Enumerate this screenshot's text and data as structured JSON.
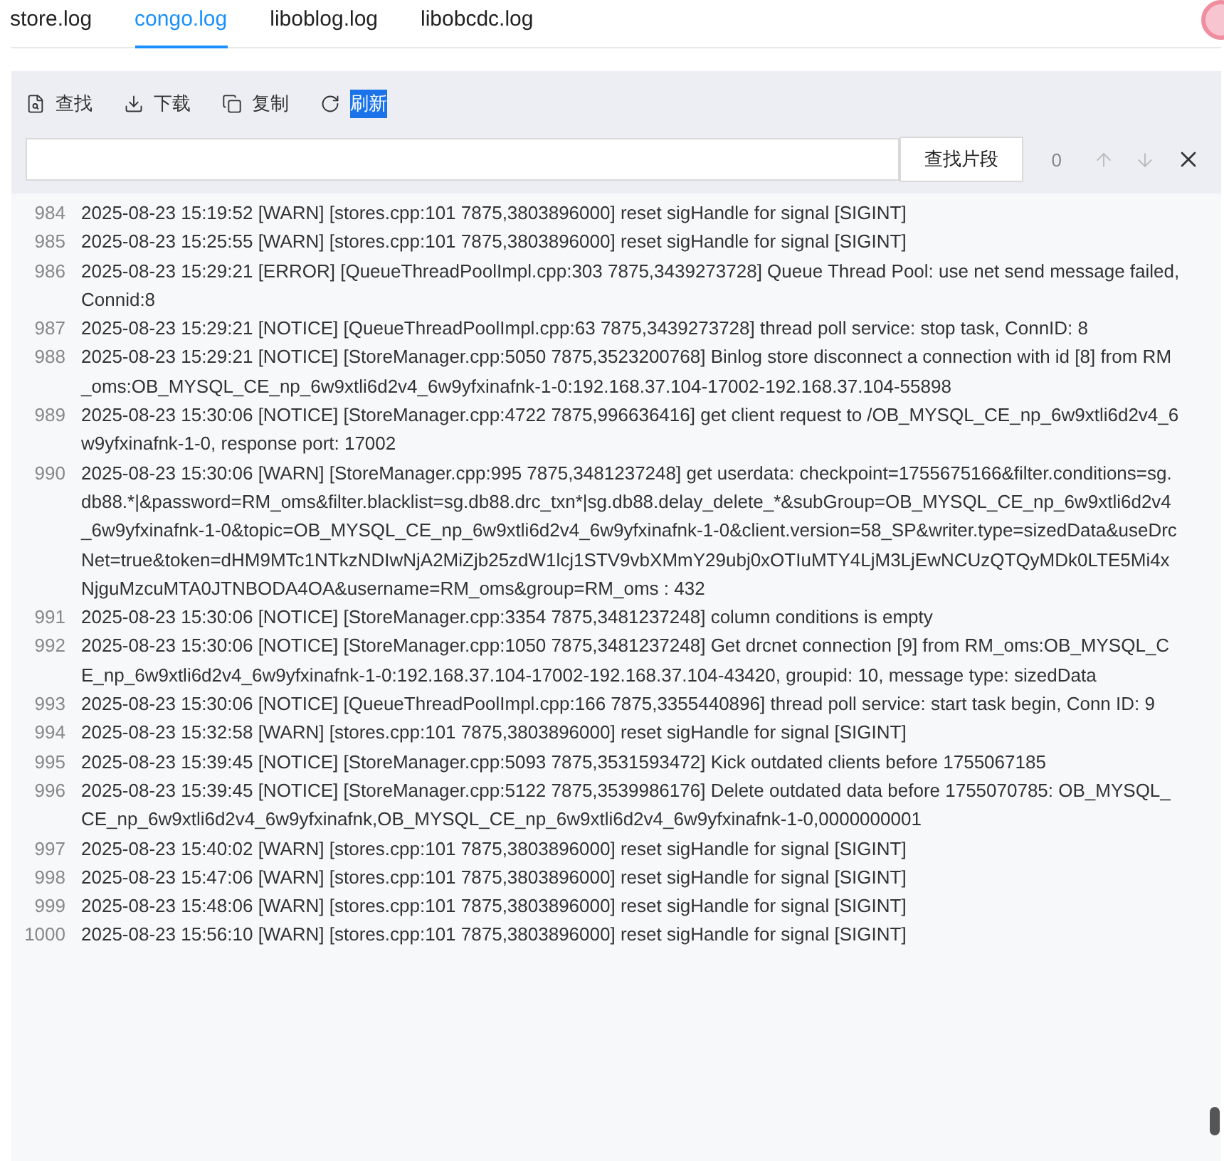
{
  "tabs": [
    {
      "label": "store.log",
      "selected": false
    },
    {
      "label": "congo.log",
      "selected": true
    },
    {
      "label": "liboblog.log",
      "selected": false
    },
    {
      "label": "libobcdc.log",
      "selected": false
    }
  ],
  "toolbar": [
    {
      "kind": "find",
      "label": "查找",
      "highlighted": false
    },
    {
      "kind": "download",
      "label": "下载",
      "highlighted": false
    },
    {
      "kind": "copy",
      "label": "复制",
      "highlighted": false
    },
    {
      "kind": "refresh",
      "label": "刷新",
      "highlighted": true
    }
  ],
  "search": {
    "button": "查找片段",
    "count": "0"
  },
  "log": [
    {
      "line": "984",
      "text": "2025-08-23 15:19:52 [WARN] [stores.cpp:101 7875,3803896000] reset sigHandle for signal [SIGINT]"
    },
    {
      "line": "985",
      "text": "2025-08-23 15:25:55 [WARN] [stores.cpp:101 7875,3803896000] reset sigHandle for signal [SIGINT]"
    },
    {
      "line": "986",
      "text": "2025-08-23 15:29:21 [ERROR] [QueueThreadPoolImpl.cpp:303 7875,3439273728] Queue Thread Pool: use net send message failed, Connid:8"
    },
    {
      "line": "987",
      "text": "2025-08-23 15:29:21 [NOTICE] [QueueThreadPoolImpl.cpp:63 7875,3439273728] thread poll service: stop task, ConnID: 8"
    },
    {
      "line": "988",
      "text": "2025-08-23 15:29:21 [NOTICE] [StoreManager.cpp:5050 7875,3523200768] Binlog store disconnect a connection with id [8] from RM_oms:OB_MYSQL_CE_np_6w9xtli6d2v4_6w9yfxinafnk-1-0:192.168.37.104-17002-192.168.37.104-55898"
    },
    {
      "line": "989",
      "text": "2025-08-23 15:30:06 [NOTICE] [StoreManager.cpp:4722 7875,996636416] get client request to /OB_MYSQL_CE_np_6w9xtli6d2v4_6w9yfxinafnk-1-0, response port: 17002"
    },
    {
      "line": "990",
      "text": "2025-08-23 15:30:06 [WARN] [StoreManager.cpp:995 7875,3481237248] get userdata: checkpoint=1755675166&filter.conditions=sg.db88.*|&password=RM_oms&filter.blacklist=sg.db88.drc_txn*|sg.db88.delay_delete_*&subGroup=OB_MYSQL_CE_np_6w9xtli6d2v4_6w9yfxinafnk-1-0&topic=OB_MYSQL_CE_np_6w9xtli6d2v4_6w9yfxinafnk-1-0&client.version=58_SP&writer.type=sizedData&useDrcNet=true&token=dHM9MTc1NTkzNDIwNjA2MiZjb25zdW1lcj1STV9vbXMmY29ubj0xOTIuMTY4LjM3LjEwNCUzQTQyMDk0LTE5Mi4xNjguMzcuMTA0JTNBODA4OA&username=RM_oms&group=RM_oms : 432"
    },
    {
      "line": "991",
      "text": "2025-08-23 15:30:06 [NOTICE] [StoreManager.cpp:3354 7875,3481237248] column conditions is empty"
    },
    {
      "line": "992",
      "text": "2025-08-23 15:30:06 [NOTICE] [StoreManager.cpp:1050 7875,3481237248] Get drcnet connection [9] from RM_oms:OB_MYSQL_CE_np_6w9xtli6d2v4_6w9yfxinafnk-1-0:192.168.37.104-17002-192.168.37.104-43420, groupid: 10, message type: sizedData"
    },
    {
      "line": "993",
      "text": "2025-08-23 15:30:06 [NOTICE] [QueueThreadPoolImpl.cpp:166 7875,3355440896] thread poll service: start task begin, Conn ID: 9"
    },
    {
      "line": "994",
      "text": "2025-08-23 15:32:58 [WARN] [stores.cpp:101 7875,3803896000] reset sigHandle for signal [SIGINT]"
    },
    {
      "line": "995",
      "text": "2025-08-23 15:39:45 [NOTICE] [StoreManager.cpp:5093 7875,3531593472] Kick outdated clients before 1755067185"
    },
    {
      "line": "996",
      "text": "2025-08-23 15:39:45 [NOTICE] [StoreManager.cpp:5122 7875,3539986176] Delete outdated data before 1755070785: OB_MYSQL_CE_np_6w9xtli6d2v4_6w9yfxinafnk,OB_MYSQL_CE_np_6w9xtli6d2v4_6w9yfxinafnk-1-0,0000000001"
    },
    {
      "line": "997",
      "text": "2025-08-23 15:40:02 [WARN] [stores.cpp:101 7875,3803896000] reset sigHandle for signal [SIGINT]"
    },
    {
      "line": "998",
      "text": "2025-08-23 15:47:06 [WARN] [stores.cpp:101 7875,3803896000] reset sigHandle for signal [SIGINT]"
    },
    {
      "line": "999",
      "text": "2025-08-23 15:48:06 [WARN] [stores.cpp:101 7875,3803896000] reset sigHandle for signal [SIGINT]"
    },
    {
      "line": "1000",
      "text": "2025-08-23 15:56:10 [WARN] [stores.cpp:101 7875,3803896000] reset sigHandle for signal [SIGINT]"
    }
  ]
}
